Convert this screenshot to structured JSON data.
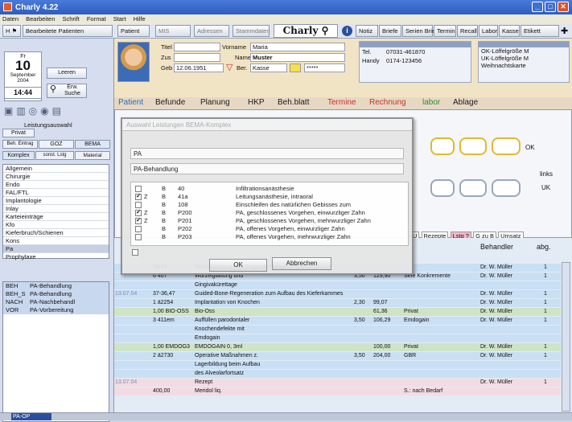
{
  "window": {
    "title": "Charly 4.22"
  },
  "menu": [
    "Daten",
    "Bearbeiten",
    "Schrift",
    "Format",
    "Start",
    "Hilfe"
  ],
  "toolbar": {
    "edited_patients": "Bearbeitete Patienten",
    "patient": "Patient",
    "mis": "MIS",
    "addresses": "Adressen",
    "masterdata": "Stammdaten",
    "logo": "Charly",
    "notes": "Notiz",
    "letters": "Briefe",
    "series_letters": "Serien Briefe",
    "appointment": "Termin",
    "recall": "Recall",
    "labor": "Labor",
    "cash": "Kasse",
    "labels": "Etikett"
  },
  "left": {
    "weekday": "Fr",
    "day": "10",
    "month": "September",
    "year": "2004",
    "time": "14:44",
    "clear": "Leeren",
    "extended_search": "Erw. Suche",
    "section": "Leistungsauswahl",
    "privat": "Privat",
    "tabs": [
      "Beh. Eintrag",
      "GOZ",
      "BEMA"
    ],
    "subtabs": [
      "Komplex",
      "sonst. Lstg",
      "Material"
    ],
    "categories": [
      "Allgemein",
      "Chirurgie",
      "Endo",
      "FAL/FTL",
      "Implantologie",
      "Inlay",
      "Karteieinträge",
      "Kfo",
      "Kieferbruch/Schienen",
      "Kons",
      "Pa",
      "Prophylaxe"
    ],
    "shortcuts": [
      [
        "BEH",
        "PA-Behandlung"
      ],
      [
        "BEH_S",
        "PA-Behandlung"
      ],
      [
        "NACH",
        "PA-Nachbehandl"
      ],
      [
        "VOR",
        "PA-Vorbereitung"
      ]
    ],
    "search_value": "PA-OP"
  },
  "patient": {
    "title_label": "Titel",
    "firstname_label": "Vorname",
    "firstname": "Maria",
    "suffix_label": "Zus",
    "name_label": "Name",
    "name": "Muster",
    "birth_label": "Geb",
    "birth": "12.06.1951",
    "insurer_label": "Ber.",
    "insurer": "Kasse",
    "tel_label": "Tel.",
    "tel": "07031-461870",
    "handy_label": "Handy",
    "handy": "0174-123456",
    "side_items": [
      "OK-Löffelgröße M",
      "UK-Löffelgröße M",
      "Weihnachtskarte"
    ]
  },
  "tabs": [
    "Patient",
    "Befunde",
    "Planung",
    "HKP",
    "Beh.blatt",
    "Termine",
    "Rechnung",
    "labor",
    "Ablage"
  ],
  "chart": {
    "labels": [
      "OK",
      "links",
      "UK"
    ],
    "buttons": [
      "AU",
      "Rezepte",
      "Lstg ?",
      "G zu B",
      "Umsatz"
    ],
    "col_behandler": "Behandler",
    "col_abg": "abg."
  },
  "rows": [
    {
      "date": "",
      "code": "33/43",
      "text": "Wurzelglättung und Gingivakürettage",
      "f": "",
      "pts": "",
      "eur": "",
      "note": "",
      "doc": "Dr. W. Müller",
      "q": "1",
      "bg": "#c9dff4"
    },
    {
      "date": "",
      "code": "6 407",
      "text": "Wurzelglättung und",
      "f": "3,50",
      "pts": "129,90",
      "eur": "",
      "note": "Sefe Konkremente",
      "doc": "Dr. W. Müller",
      "q": "1",
      "bg": "#c9dff4"
    },
    {
      "date": "",
      "code": "",
      "text": "Gingivakürettage",
      "f": "",
      "pts": "",
      "eur": "",
      "note": "",
      "doc": "",
      "q": "",
      "bg": "#c9dff4"
    },
    {
      "date": "13.07.04",
      "code": "37-36,47",
      "text": "Guided-Bone-Regeneration zum Aufbau des Kieferkammes",
      "f": "",
      "pts": "",
      "eur": "",
      "note": "",
      "doc": "Dr. W. Müller",
      "q": "1",
      "bg": "#c9dff4"
    },
    {
      "date": "",
      "code": "1 ä2254",
      "text": "Implantation von Knochen",
      "f": "2,30",
      "pts": "99,07",
      "eur": "",
      "note": "",
      "doc": "Dr. W. Müller",
      "q": "1",
      "bg": "#c9dff4"
    },
    {
      "date": "",
      "code": "1,00 BIO-OSS",
      "text": "Bio-Oss",
      "f": "",
      "pts": "61,36",
      "eur": "",
      "note": "Privat",
      "doc": "Dr. W. Müller",
      "q": "1",
      "bg": "#cfe3c6"
    },
    {
      "date": "",
      "code": "3 411em",
      "text": "Auffüllen parodontaler",
      "f": "3,50",
      "pts": "106,29",
      "eur": "",
      "note": "Emdogain",
      "doc": "Dr. W. Müller",
      "q": "1",
      "bg": "#c9dff4"
    },
    {
      "date": "",
      "code": "",
      "text": "Knochendefekte mit",
      "f": "",
      "pts": "",
      "eur": "",
      "note": "",
      "doc": "",
      "q": "",
      "bg": "#c9dff4"
    },
    {
      "date": "",
      "code": "",
      "text": "Emdogain",
      "f": "",
      "pts": "",
      "eur": "",
      "note": "",
      "doc": "",
      "q": "",
      "bg": "#c9dff4"
    },
    {
      "date": "",
      "code": "1,00 EMDOG3",
      "text": "EMDOGAIN 0, 3ml",
      "f": "",
      "pts": "100,00",
      "eur": "",
      "note": "Privat",
      "doc": "Dr. W. Müller",
      "q": "1",
      "bg": "#cfe3c6"
    },
    {
      "date": "",
      "code": "2 ä2730",
      "text": "Operative Maßnahmen z.",
      "f": "3,50",
      "pts": "204,00",
      "eur": "",
      "note": "GBR",
      "doc": "Dr. W. Müller",
      "q": "1",
      "bg": "#c9dff4"
    },
    {
      "date": "",
      "code": "",
      "text": "Lagerbildung beim Aufbau",
      "f": "",
      "pts": "",
      "eur": "",
      "note": "",
      "doc": "",
      "q": "",
      "bg": "#c9dff4"
    },
    {
      "date": "",
      "code": "",
      "text": "des Alveolarfortsatz",
      "f": "",
      "pts": "",
      "eur": "",
      "note": "",
      "doc": "",
      "q": "",
      "bg": "#c9dff4"
    },
    {
      "date": "13.07.04",
      "code": "",
      "text": "Rezept",
      "f": "",
      "pts": "",
      "eur": "",
      "note": "",
      "doc": "Dr. W. Müller",
      "q": "1",
      "bg": "#f2dce2"
    },
    {
      "date": "",
      "code": "400,00",
      "text": "Meridol liq.",
      "f": "",
      "pts": "",
      "eur": "",
      "note": "S.: nach Bedarf",
      "doc": "",
      "q": "",
      "bg": "#f2dce2"
    }
  ],
  "dialog": {
    "title": "Auswahl Leistungen BEMA-Komplex",
    "search": "PA",
    "selected": "PA-Behandlung",
    "items": [
      {
        "check": "",
        "z": "",
        "type": "B",
        "code": "40",
        "text": "Infiltrationsanästhesie"
      },
      {
        "check": "✔",
        "z": "Z",
        "type": "B",
        "code": "41a",
        "text": "Leitungsanästhesie, intraoral"
      },
      {
        "check": "",
        "z": "",
        "type": "B",
        "code": "108",
        "text": "Einschleifen des natürlichen Gebisses zum"
      },
      {
        "check": "✔",
        "z": "Z",
        "type": "B",
        "code": "P200",
        "text": "PA, geschlossenes Vorgehen, einwurzliger Zahn"
      },
      {
        "check": "✔",
        "z": "Z",
        "type": "B",
        "code": "P201",
        "text": "PA, geschlossenes Vorgehen, mehrwurzliger Zahn"
      },
      {
        "check": "",
        "z": "",
        "type": "B",
        "code": "P202",
        "text": "PA, offenes Vorgehen, einwurzliger Zahn"
      },
      {
        "check": "",
        "z": "",
        "type": "B",
        "code": "P203",
        "text": "PA, offenes Vorgehen, mehrwurzliger Zahn"
      }
    ],
    "ok": "OK",
    "cancel": "Abbrechen"
  },
  "colors": {
    "title": "#2f5cc2",
    "tab_red": "#c2312f",
    "green_tab": "#2c8a3a",
    "tooth": "#e0b930"
  }
}
